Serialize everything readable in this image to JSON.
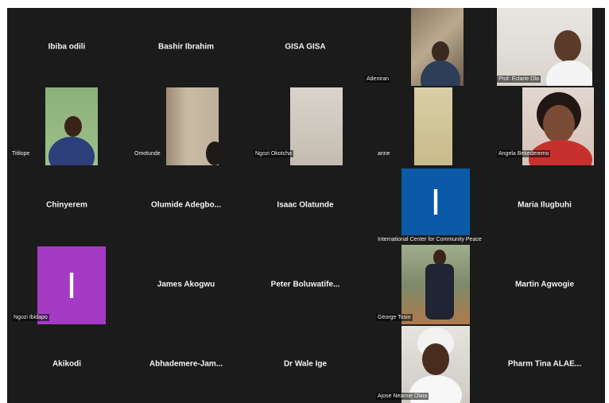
{
  "gallery": {
    "row1": {
      "p1": "Ibiba odili",
      "p2": "Bashir Ibrahim",
      "p3": "GISA GISA",
      "p4": "Adeniran",
      "p5": "Prof. Eclarie Ola"
    },
    "row2": {
      "p1": "Titilope",
      "p2": "Omotunde",
      "p3": "Ngozi Okotcha",
      "p4": "anne",
      "p5": "Angela Bekederemo"
    },
    "row3": {
      "p1": "Chinyerem",
      "p2": "Olumide  Adegbo...",
      "p3": "Isaac Olatunde",
      "p4": "International Center for Community Peace",
      "p4_initial": "I",
      "p5": "Maria Ilugbuhi"
    },
    "row4": {
      "p1": "Ngozi Ibidapo",
      "p1_initial": "I",
      "p2": "James Akogwu",
      "p3": "Peter  Boluwatife...",
      "p4": "George Tosin",
      "p5": "Martin Agwogie"
    },
    "row5": {
      "p1": "Akikodi",
      "p2": "Abhademere-Jam...",
      "p3": "Dr Wale Ige",
      "p4": "Ajose Nearnie Olaia",
      "p5": "Pharm  Tina  ALAE..."
    }
  },
  "colors": {
    "background": "#1b1b1b",
    "avatar_blue": "#0a5aa8",
    "avatar_purple": "#a53bc4"
  }
}
